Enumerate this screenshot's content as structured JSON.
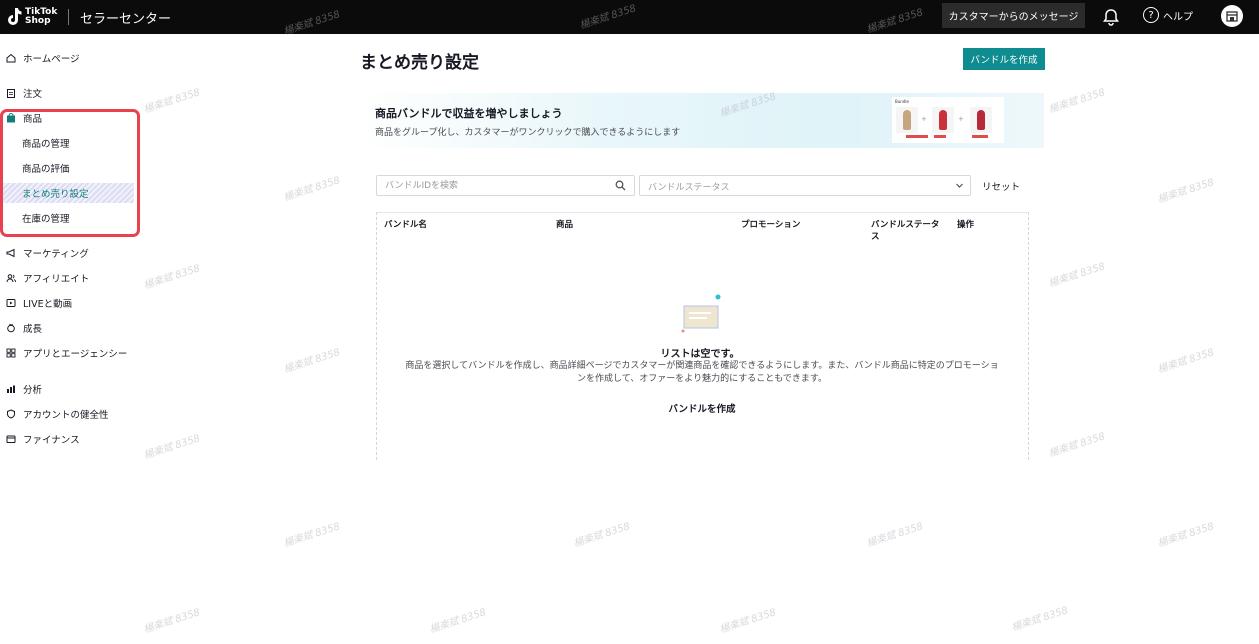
{
  "header": {
    "logo_text": "TikTok\nShop",
    "title": "セラーセンター",
    "messages_label": "カスタマーからのメッセージ",
    "help_label": "ヘルプ"
  },
  "sidebar": {
    "items": [
      {
        "label": "ホームページ",
        "icon": "home-icon"
      },
      {
        "label": "注文",
        "icon": "clipboard-icon"
      },
      {
        "label": "商品",
        "icon": "bag-icon"
      },
      {
        "label": "マーケティング",
        "icon": "megaphone-icon"
      },
      {
        "label": "アフィリエイト",
        "icon": "users-icon"
      },
      {
        "label": "LIVEと動画",
        "icon": "video-icon"
      },
      {
        "label": "成長",
        "icon": "growth-icon"
      },
      {
        "label": "アプリとエージェンシー",
        "icon": "apps-icon"
      },
      {
        "label": "分析",
        "icon": "chart-icon"
      },
      {
        "label": "アカウントの健全性",
        "icon": "shield-icon"
      },
      {
        "label": "ファイナンス",
        "icon": "wallet-icon"
      }
    ],
    "product_sub": [
      {
        "label": "商品の管理"
      },
      {
        "label": "商品の評価"
      },
      {
        "label": "まとめ売り設定"
      },
      {
        "label": "在庫の管理"
      }
    ]
  },
  "main": {
    "title": "まとめ売り設定",
    "create_label": "バンドルを作成",
    "banner": {
      "title": "商品バンドルで収益を増やしましょう",
      "subtitle": "商品をグループ化し、カスタマーがワンクリックで購入できるようにします",
      "image_label": "Bundle"
    },
    "search": {
      "placeholder": "バンドルIDを検索"
    },
    "status_filter": {
      "placeholder": "バンドルステータス"
    },
    "reset_label": "リセット",
    "columns": [
      "バンドル名",
      "商品",
      "プロモーション",
      "バンドルステータ\nス",
      "操作"
    ],
    "empty": {
      "title": "リストは空です。",
      "description": "商品を選択してバンドルを作成し、商品詳細ページでカスタマーが関連商品を確認できるようにします。また、バンドル商品に特定のプロモーションを作成して、オファーをより魅力的にすることもできます。",
      "create_label": "バンドルを作成"
    }
  },
  "colors": {
    "header_bg": "#0b0b0b",
    "accent": "#0e8c8f",
    "highlight_border": "#e8414f",
    "active_text": "#147d7b"
  },
  "watermark_text": "楊楽斌 8358"
}
